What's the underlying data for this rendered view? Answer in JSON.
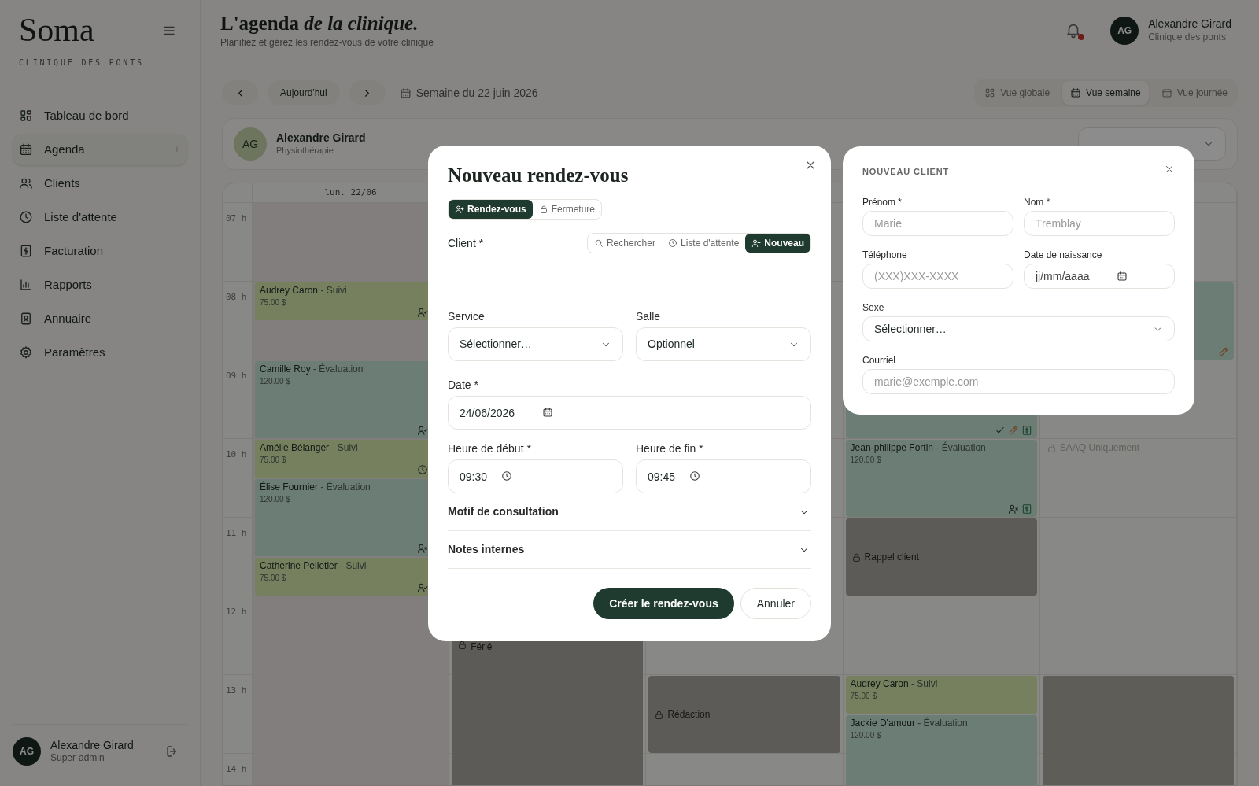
{
  "sidebar": {
    "logo": "Soma",
    "subtitle": "CLINIQUE DES PONTS",
    "items": [
      {
        "label": "Tableau de bord",
        "selected": false
      },
      {
        "label": "Agenda",
        "selected": true
      },
      {
        "label": "Clients",
        "selected": false
      },
      {
        "label": "Liste d'attente",
        "selected": false
      },
      {
        "label": "Facturation",
        "selected": false
      },
      {
        "label": "Rapports",
        "selected": false
      },
      {
        "label": "Annuaire",
        "selected": false
      },
      {
        "label": "Paramètres",
        "selected": false
      }
    ],
    "user": {
      "initials": "AG",
      "name": "Alexandre Girard",
      "role": "Super-admin"
    }
  },
  "header": {
    "title": "L'agenda *de la clinique.*",
    "subtitle": "Planifiez et gérez les rendez-vous de votre clinique",
    "notification_unread": true,
    "user": {
      "initials": "AG",
      "name": "Alexandre Girard",
      "clinic": "Clinique des ponts"
    }
  },
  "toolbar": {
    "today": "Aujourd'hui",
    "week_label": "Semaine du 22 juin 2026",
    "views": [
      {
        "label": "Vue globale",
        "selected": false
      },
      {
        "label": "Vue semaine",
        "selected": true
      },
      {
        "label": "Vue journée",
        "selected": false
      }
    ]
  },
  "practitioner": {
    "initials": "AG",
    "name": "Alexandre Girard",
    "specialty": "Physiothérapie"
  },
  "calendar": {
    "hours": [
      "07 h",
      "08 h",
      "09 h",
      "10 h",
      "11 h",
      "12 h",
      "13 h",
      "14 h"
    ],
    "columns": [
      {
        "header": "lun. 22/06",
        "events": [
          {
            "kind": "empty"
          },
          {
            "kind": "empty"
          },
          {
            "kind": "short",
            "client": "Audrey Caron",
            "service": "- Suivi",
            "price": "75.00 $",
            "color": "#76805f",
            "confirmed": true
          },
          {
            "kind": "empty"
          },
          {
            "kind": "long",
            "client": "Camille Roy",
            "service": "- Évaluation",
            "price": "120.00 $",
            "color": "#6b7d74",
            "confirmed": true
          },
          {
            "kind": "short",
            "client": "Amélie Bélanger",
            "service": "- Suivi",
            "price": "75.00 $",
            "color": "#76805f",
            "waiting": true
          },
          {
            "kind": "long",
            "client": "Élise Fournier",
            "service": "- Évaluation",
            "price": "120.00 $",
            "color": "#6b7d74",
            "no_show": true
          },
          {
            "kind": "short",
            "client": "Catherine Pelletier",
            "service": "- Suivi",
            "price": "75.00 $",
            "color": "#76805f",
            "confirmed": true
          }
        ]
      },
      {
        "events": [
          {
            "kind": "empty"
          },
          {
            "kind": "empty"
          },
          {
            "kind": "empty"
          },
          {
            "kind": "empty"
          },
          {
            "kind": "empty"
          },
          {
            "kind": "empty"
          },
          {
            "kind": "empty"
          },
          {
            "kind": "empty"
          },
          {
            "kind": "empty"
          },
          {
            "kind": "empty"
          },
          {
            "kind": "empty"
          },
          {
            "kind": "holiday",
            "label": "Férié"
          }
        ]
      },
      {
        "events": [
          {
            "kind": "empty"
          },
          {
            "kind": "empty"
          },
          {
            "kind": "empty"
          },
          {
            "kind": "empty"
          },
          {
            "kind": "empty"
          },
          {
            "kind": "empty"
          },
          {
            "kind": "empty"
          },
          {
            "kind": "empty"
          },
          {
            "kind": "empty"
          },
          {
            "kind": "empty"
          },
          {
            "kind": "empty"
          },
          {
            "kind": "empty"
          },
          {
            "kind": "closure",
            "label": "Rédaction"
          }
        ]
      },
      {
        "events": [
          {
            "kind": "empty"
          },
          {
            "kind": "empty"
          },
          {
            "kind": "empty"
          },
          {
            "kind": "empty"
          },
          {
            "kind": "long",
            "color": "#6b7d74",
            "done": true,
            "edited": true,
            "invoiced": true
          },
          {
            "kind": "long",
            "client": "Jean-philippe Fortin",
            "service": "- Évaluation",
            "price": "120.00 $",
            "color": "#6b7d74",
            "no_show": true,
            "invoiced": true
          },
          {
            "kind": "closure",
            "label": "Rappel client"
          },
          {
            "kind": "empty"
          },
          {
            "kind": "empty"
          },
          {
            "kind": "short",
            "client": "Audrey Caron",
            "service": "- Suivi",
            "price": "75.00 $",
            "color": "#76805f"
          },
          {
            "kind": "extended",
            "client": "Jackie D'amour",
            "service": "- Évaluation",
            "price": "120.00 $",
            "color": "#6b7d74"
          }
        ]
      },
      {
        "events": [
          {
            "kind": "empty"
          },
          {
            "kind": "empty"
          },
          {
            "kind": "long",
            "color": "#6b7d74",
            "edited": true
          },
          {
            "kind": "empty"
          },
          {
            "kind": "empty"
          },
          {
            "kind": "note",
            "label": "SAAQ Uniquement"
          },
          {
            "kind": "empty"
          },
          {
            "kind": "empty"
          },
          {
            "kind": "empty"
          },
          {
            "kind": "empty"
          },
          {
            "kind": "empty"
          },
          {
            "kind": "empty"
          },
          {
            "kind": "unavailable"
          }
        ]
      }
    ]
  },
  "appointment_modal": {
    "title": "Nouveau rendez-vous",
    "modes": [
      {
        "label": "Rendez-vous",
        "selected": true
      },
      {
        "label": "Fermeture",
        "selected": false
      }
    ],
    "client_label": "Client *",
    "client_modes": [
      {
        "label": "Rechercher",
        "selected": false
      },
      {
        "label": "Liste d'attente",
        "selected": false
      },
      {
        "label": "Nouveau",
        "selected": true
      }
    ],
    "service": {
      "label": "Service",
      "value": "Sélectionner…"
    },
    "room": {
      "label": "Salle",
      "value": "Optionnel"
    },
    "date": {
      "label": "Date *",
      "value": "24/06/2026"
    },
    "start": {
      "label": "Heure de début *",
      "value": "09:30"
    },
    "end": {
      "label": "Heure de fin *",
      "value": "09:45"
    },
    "sections": [
      {
        "label": "Motif de consultation",
        "expanded": false
      },
      {
        "label": "Notes internes",
        "expanded": false
      }
    ],
    "submit": "Créer le rendez-vous",
    "cancel": "Annuler"
  },
  "client_panel": {
    "title": "NOUVEAU CLIENT",
    "fields": [
      {
        "kind": "text",
        "label": "Prénom *",
        "placeholder": "Marie"
      },
      {
        "kind": "text",
        "label": "Nom *",
        "placeholder": "Tremblay"
      },
      {
        "kind": "text",
        "label": "Téléphone",
        "placeholder": "(XXX)XXX-XXXX"
      },
      {
        "kind": "date",
        "label": "Date de naissance",
        "placeholder": "jj/mm/aaaa"
      },
      {
        "kind": "select",
        "label": "Sexe",
        "value": "Sélectionner…"
      },
      {
        "kind": "email",
        "label": "Courriel",
        "placeholder": "marie@exemple.com"
      }
    ]
  }
}
